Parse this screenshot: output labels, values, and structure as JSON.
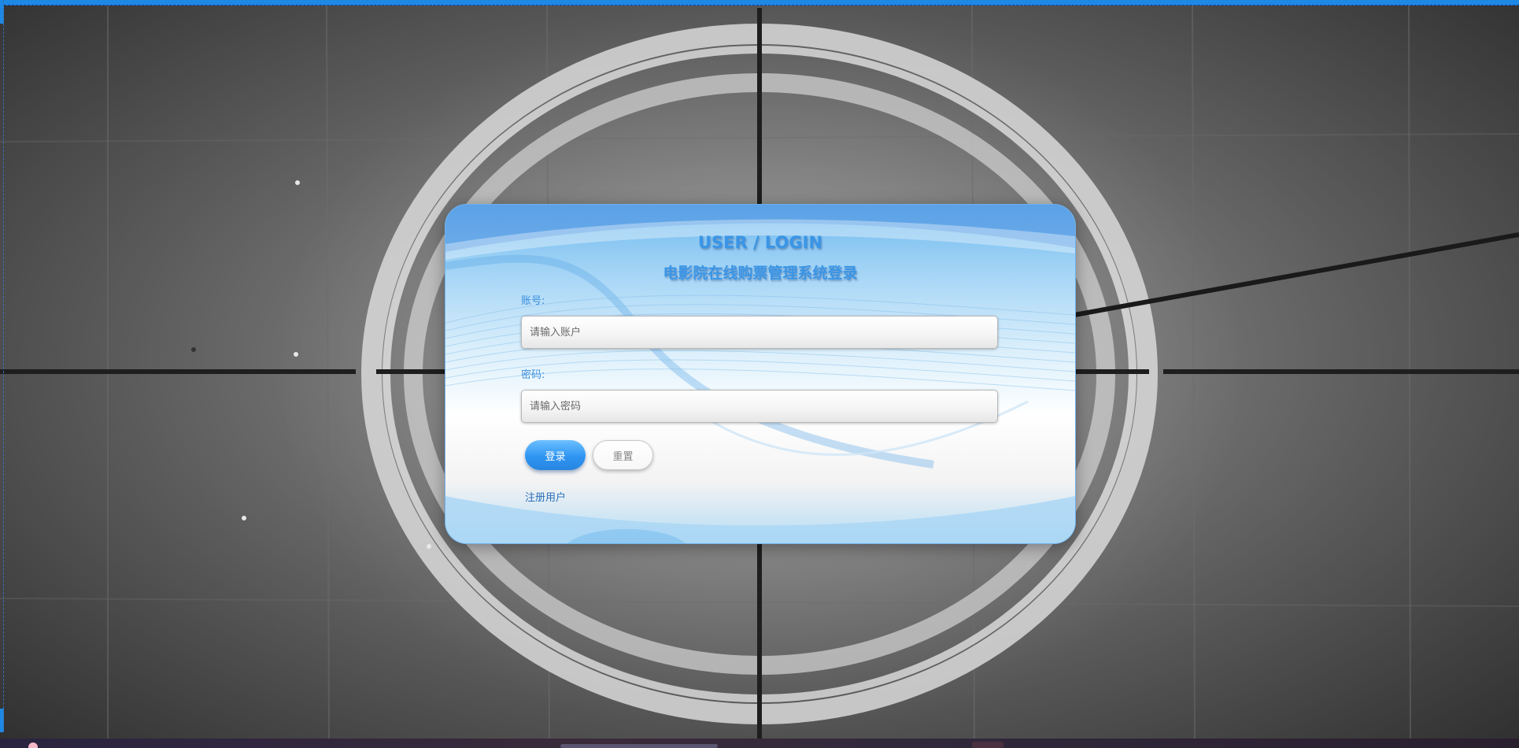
{
  "login": {
    "title": "USER / LOGIN",
    "subtitle": "电影院在线购票管理系统登录",
    "account_label": "账号:",
    "account_placeholder": "请输入账户",
    "account_value": "",
    "password_label": "密码:",
    "password_placeholder": "请输入密码",
    "password_value": "",
    "login_button": "登录",
    "reset_button": "重置",
    "register_link": "注册用户"
  },
  "colors": {
    "accent": "#3a95e6",
    "login_button": "#2f95f2",
    "link": "#2a6fb8"
  },
  "background": {
    "icon": "film-countdown-leader-icon"
  }
}
